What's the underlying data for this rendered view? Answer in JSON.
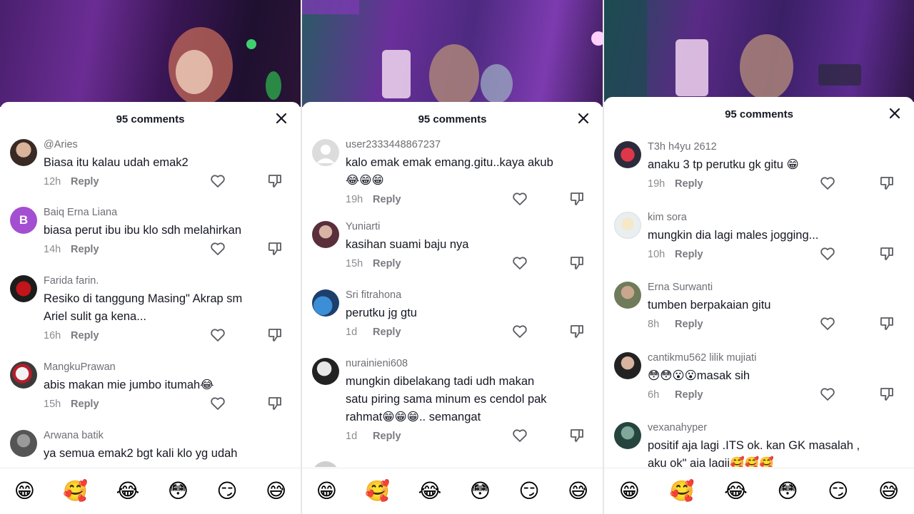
{
  "panels": [
    {
      "header": {
        "title": "95 comments"
      },
      "comments": [
        {
          "username": "@Aries",
          "text": "Biasa itu kalau udah emak2",
          "time": "12h",
          "reply": "Reply"
        },
        {
          "username": "Baiq Erna Liana",
          "avatar_letter": "B",
          "text": "biasa perut ibu ibu klo sdh melahirkan",
          "time": "14h",
          "reply": "Reply"
        },
        {
          "username": "Farida farin.",
          "text": "Resiko di tanggung Masing\" Akrap sm Ariel sulit ga kena...",
          "time": "16h",
          "reply": "Reply"
        },
        {
          "username": "MangkuPrawan",
          "text": "abis makan mie jumbo itumah😂",
          "time": "15h",
          "reply": "Reply"
        },
        {
          "username": "Arwana batik",
          "text": "ya semua emak2 bgt kali klo yg udah"
        }
      ],
      "emojis": [
        "😁",
        "🥰",
        "😂",
        "😳",
        "😏",
        "😅"
      ]
    },
    {
      "header": {
        "title": "95 comments"
      },
      "comments": [
        {
          "username": "user2333448867237",
          "text": "kalo emak emak emang.gitu..kaya akub 😂😁😁",
          "time": "19h",
          "reply": "Reply"
        },
        {
          "username": "Yuniarti",
          "text": "kasihan suami baju nya",
          "time": "15h",
          "reply": "Reply"
        },
        {
          "username": "Sri fitrahona",
          "text": "perutku jg gtu",
          "time": "1d",
          "reply": "Reply"
        },
        {
          "username": "nurainieni608",
          "text": "mungkin dibelakang tadi udh makan satu piring sama minum es cendol pak rahmat😁😁😁.. semangat",
          "time": "1d",
          "reply": "Reply"
        }
      ],
      "emojis": [
        "😁",
        "🥰",
        "😂",
        "😳",
        "😏",
        "😅"
      ]
    },
    {
      "header": {
        "title": "95 comments"
      },
      "comments": [
        {
          "username": "T3h h4yu 2612",
          "text": "anaku 3 tp perutku gk gitu 😁",
          "time": "19h",
          "reply": "Reply"
        },
        {
          "username": "kim sora",
          "text": "mungkin dia lagi males jogging...",
          "time": "10h",
          "reply": "Reply"
        },
        {
          "username": "Erna Surwanti",
          "text": "tumben berpakaian gitu",
          "time": "8h",
          "reply": "Reply"
        },
        {
          "username": "cantikmu562  lilik  mujiati",
          "text": "😳😳😮😮masak sih",
          "time": "6h",
          "reply": "Reply"
        },
        {
          "username": "vexanahyper",
          "text": "positif aja lagi .ITS ok. kan GK masalah , aku ok\" aja lagii🥰🥰🥰"
        }
      ],
      "emojis": [
        "😁",
        "🥰",
        "😂",
        "😳",
        "😏",
        "😅"
      ]
    }
  ],
  "colors": {
    "text_primary": "#161823",
    "text_secondary": "#6e6f75",
    "avatar_b": "#a34fd1"
  },
  "icons": {
    "close": "close-icon",
    "like": "heart-outline-icon",
    "dislike": "thumbs-down-outline-icon"
  }
}
